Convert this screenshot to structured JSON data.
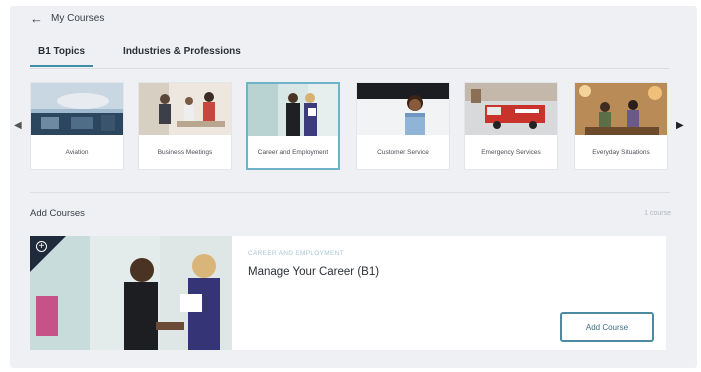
{
  "nav": {
    "back_label": "My Courses",
    "back_icon": "arrow-left-icon"
  },
  "tabs": [
    {
      "label": "B1 Topics",
      "active": true
    },
    {
      "label": "Industries & Professions",
      "active": false
    }
  ],
  "carousel": {
    "cards": [
      {
        "label": "Aviation",
        "selected": false
      },
      {
        "label": "Business Meetings",
        "selected": false
      },
      {
        "label": "Career and Employment",
        "selected": true
      },
      {
        "label": "Customer Service",
        "selected": false
      },
      {
        "label": "Emergency Services",
        "selected": false
      },
      {
        "label": "Everyday Situations",
        "selected": false
      }
    ]
  },
  "add_courses": {
    "title": "Add Courses",
    "count": "1 course",
    "course": {
      "eyebrow": "CAREER AND EMPLOYMENT",
      "title": "Manage Your Career (B1)",
      "button": "Add Course"
    }
  },
  "colors": {
    "accent": "#3e8ea7",
    "selected_border": "#6fb3c9",
    "badge": "#1f2a3a"
  }
}
